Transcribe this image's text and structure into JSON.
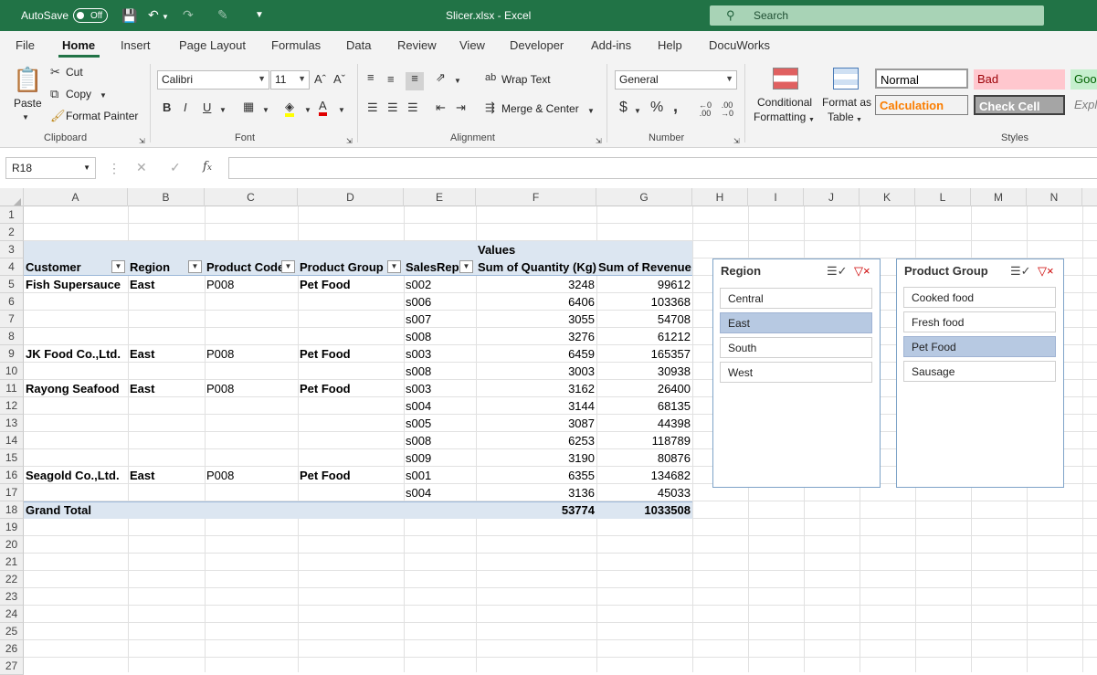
{
  "title_bar": {
    "autosave_label": "AutoSave",
    "autosave_state": "Off",
    "file_title": "Slicer.xlsx  -  Excel",
    "search_placeholder": "Search"
  },
  "tabs": [
    "File",
    "Home",
    "Insert",
    "Page Layout",
    "Formulas",
    "Data",
    "Review",
    "View",
    "Developer",
    "Add-ins",
    "Help",
    "DocuWorks"
  ],
  "active_tab": "Home",
  "ribbon": {
    "clipboard": {
      "paste": "Paste",
      "cut": "Cut",
      "copy": "Copy",
      "format_painter": "Format Painter",
      "label": "Clipboard"
    },
    "font": {
      "name": "Calibri",
      "size": "11",
      "label": "Font"
    },
    "alignment": {
      "wrap_text": "Wrap Text",
      "merge_center": "Merge & Center",
      "label": "Alignment"
    },
    "number": {
      "format": "General",
      "label": "Number"
    },
    "styles": {
      "conditional_formatting_1": "Conditional",
      "conditional_formatting_2": "Formatting",
      "format_as_table_1": "Format as",
      "format_as_table_2": "Table",
      "normal": "Normal",
      "bad": "Bad",
      "good": "Goo",
      "calculation": "Calculation",
      "check_cell": "Check Cell",
      "explanatory": "Expl",
      "label": "Styles"
    }
  },
  "formula_bar": {
    "name_box": "R18",
    "value": ""
  },
  "columns": [
    "A",
    "B",
    "C",
    "D",
    "E",
    "F",
    "G",
    "H",
    "I",
    "J",
    "K",
    "L",
    "M",
    "N"
  ],
  "rows": [
    "1",
    "2",
    "3",
    "4",
    "5",
    "6",
    "7",
    "8",
    "9",
    "10",
    "11",
    "12",
    "13",
    "14",
    "15",
    "16",
    "17",
    "18",
    "19",
    "20",
    "21",
    "22",
    "23",
    "24",
    "25",
    "26",
    "27"
  ],
  "pivot": {
    "values_header": "Values",
    "headers": [
      "Customer",
      "Region",
      "Product Code",
      "Product Group",
      "SalesRep",
      "Sum of Quantity (Kg)",
      "Sum of Revenue"
    ],
    "rows": [
      {
        "customer": "Fish Supersauce",
        "region": "East",
        "code": "P008",
        "group": "Pet Food",
        "rep": "s002",
        "qty": "3248",
        "rev": "99612"
      },
      {
        "customer": "",
        "region": "",
        "code": "",
        "group": "",
        "rep": "s006",
        "qty": "6406",
        "rev": "103368"
      },
      {
        "customer": "",
        "region": "",
        "code": "",
        "group": "",
        "rep": "s007",
        "qty": "3055",
        "rev": "54708"
      },
      {
        "customer": "",
        "region": "",
        "code": "",
        "group": "",
        "rep": "s008",
        "qty": "3276",
        "rev": "61212"
      },
      {
        "customer": "JK Food Co.,Ltd.",
        "region": "East",
        "code": "P008",
        "group": "Pet Food",
        "rep": "s003",
        "qty": "6459",
        "rev": "165357"
      },
      {
        "customer": "",
        "region": "",
        "code": "",
        "group": "",
        "rep": "s008",
        "qty": "3003",
        "rev": "30938"
      },
      {
        "customer": "Rayong Seafood",
        "region": "East",
        "code": "P008",
        "group": "Pet Food",
        "rep": "s003",
        "qty": "3162",
        "rev": "26400"
      },
      {
        "customer": "",
        "region": "",
        "code": "",
        "group": "",
        "rep": "s004",
        "qty": "3144",
        "rev": "68135"
      },
      {
        "customer": "",
        "region": "",
        "code": "",
        "group": "",
        "rep": "s005",
        "qty": "3087",
        "rev": "44398"
      },
      {
        "customer": "",
        "region": "",
        "code": "",
        "group": "",
        "rep": "s008",
        "qty": "6253",
        "rev": "118789"
      },
      {
        "customer": "",
        "region": "",
        "code": "",
        "group": "",
        "rep": "s009",
        "qty": "3190",
        "rev": "80876"
      },
      {
        "customer": "Seagold Co.,Ltd.",
        "region": "East",
        "code": "P008",
        "group": "Pet Food",
        "rep": "s001",
        "qty": "6355",
        "rev": "134682"
      },
      {
        "customer": "",
        "region": "",
        "code": "",
        "group": "",
        "rep": "s004",
        "qty": "3136",
        "rev": "45033"
      }
    ],
    "grand_total": {
      "label": "Grand Total",
      "qty": "53774",
      "rev": "1033508"
    }
  },
  "slicers": {
    "region": {
      "title": "Region",
      "items": [
        "Central",
        "East",
        "South",
        "West"
      ],
      "selected": "East"
    },
    "product_group": {
      "title": "Product Group",
      "items": [
        "Cooked food",
        "Fresh food",
        "Pet Food",
        "Sausage"
      ],
      "selected": "Pet Food"
    }
  },
  "colors": {
    "accent": "#217346",
    "pivot_header": "#dce6f1",
    "slicer_selected": "#b7c9e2"
  }
}
